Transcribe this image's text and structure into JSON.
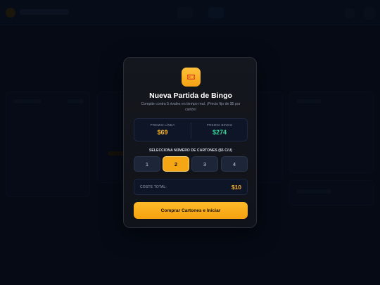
{
  "modal": {
    "title": "Nueva Partida de Bingo",
    "subtitle": "Compite contra 5 rivales en tiempo real. ¡Precio fijo de $5 por cartón!",
    "icon": "ticket-icon",
    "prizes": {
      "line_label": "PREMIO LÍNEA",
      "line_value": "$69",
      "bingo_label": "PREMIO BINGO",
      "bingo_value": "$274"
    },
    "select_label": "SELECCIONA NÚMERO DE CARTONES ($5 C/U)",
    "card_options": [
      "1",
      "2",
      "3",
      "4"
    ],
    "selected_option": "2",
    "cost_label": "COSTE TOTAL:",
    "cost_value": "$10",
    "buy_button_label": "Comprar Cartones e Iniciar"
  },
  "colors": {
    "accent": "#f5a614",
    "prize_line": "#f7b52b",
    "prize_bingo": "#36d399",
    "background": "#060b18"
  }
}
